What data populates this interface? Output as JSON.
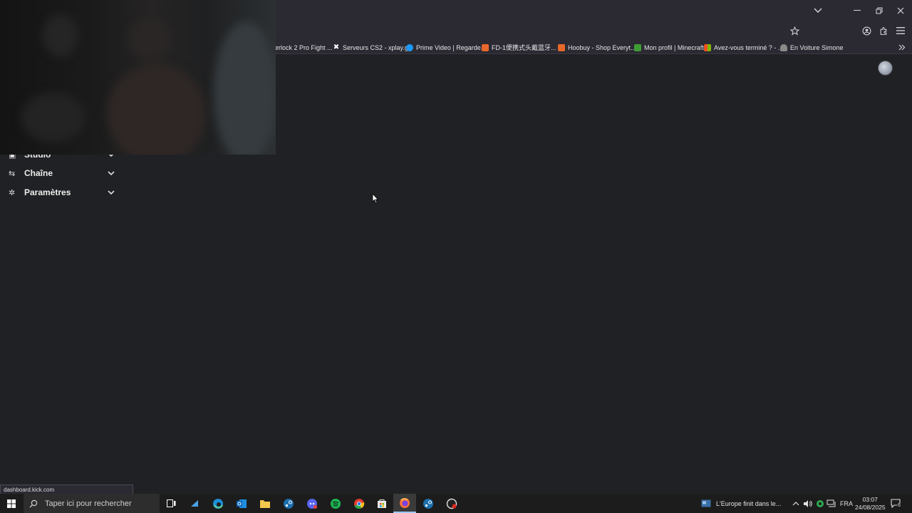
{
  "bookmarks": [
    {
      "label": "erlock 2 Pro Fight ..."
    },
    {
      "label": "Serveurs CS2 - xplay.gg"
    },
    {
      "label": "Prime Video | Regarde..."
    },
    {
      "label": "FD-1便携式头戴蓝牙..."
    },
    {
      "label": "Hoobuy - Shop Everyt..."
    },
    {
      "label": "Mon profil | Minecraft"
    },
    {
      "label": "Avez-vous terminé ? - ..."
    },
    {
      "label": "En Voiture Simone"
    }
  ],
  "sidebar": {
    "items": [
      {
        "label": "Studio"
      },
      {
        "label": "Chaîne"
      },
      {
        "label": "Paramètres"
      }
    ]
  },
  "status_bar": {
    "url": "dashboard.kick.com"
  },
  "taskbar": {
    "search_placeholder": "Taper ici pour rechercher",
    "news": "L'Europe finit dans le...",
    "language": "FRA",
    "time": "03:07",
    "date": "24/08/2025",
    "notifications": "6"
  },
  "colors": {
    "background": "#202124",
    "browser_chrome": "#2b2a33",
    "taskbar": "#1c1c1c"
  }
}
